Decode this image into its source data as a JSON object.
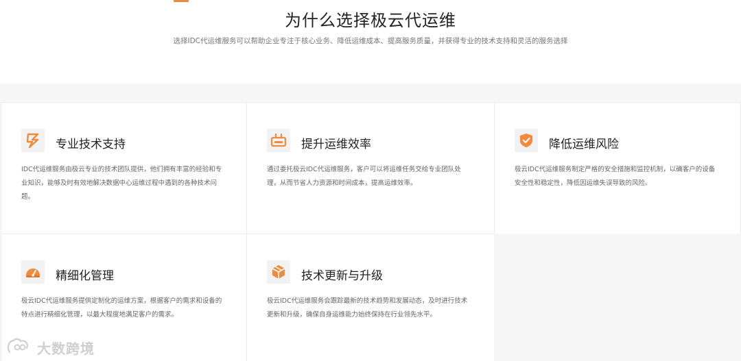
{
  "header": {
    "title": "为什么选择极云代运维",
    "subtitle": "选择IDC代运维服务可以帮助企业专注于核心业务、降低运维成本、提高服务质量，并获得专业的技术支持和灵活的服务选择"
  },
  "colors": {
    "accent": "#f08a3c",
    "accent_dark": "#e8702a",
    "icon_bg": "#f2f2f2"
  },
  "cards": [
    {
      "icon": "lightning-icon",
      "title": "专业技术支持",
      "desc": "IDC代运维服务由极云专业的技术团队提供，他们拥有丰富的经验和专业知识，能够及时有效地解决数据中心运维过程中遇到的各种技术问题。"
    },
    {
      "icon": "router-icon",
      "title": "提升运维效率",
      "desc": "通过委托极云IDC代运维服务，客户可以将运维任务交给专业团队处理，从而节省人力资源和时间成本，提高运维效率。"
    },
    {
      "icon": "shield-icon",
      "title": "降低运维风险",
      "desc": "极云IDC代运维服务制定严格的安全措施和监控机制，以确客户的设备安全性和稳定性，降低因运维失误导致的风险。"
    },
    {
      "icon": "gauge-icon",
      "title": "精细化管理",
      "desc": "极云IDC代运维服务提供定制化的运维方案，根据客户的需求和设备的特点进行精细化管理，以最大程度地满足客户的需求。"
    },
    {
      "icon": "cube-icon",
      "title": "技术更新与升级",
      "desc": "极云IDC代运维服务会跟踪最新的技术趋势和发展动态，及时进行技术更新和升级，确保自身运维能力始终保持在行业领先水平。"
    }
  ],
  "watermark": {
    "text": "大数跨境"
  }
}
